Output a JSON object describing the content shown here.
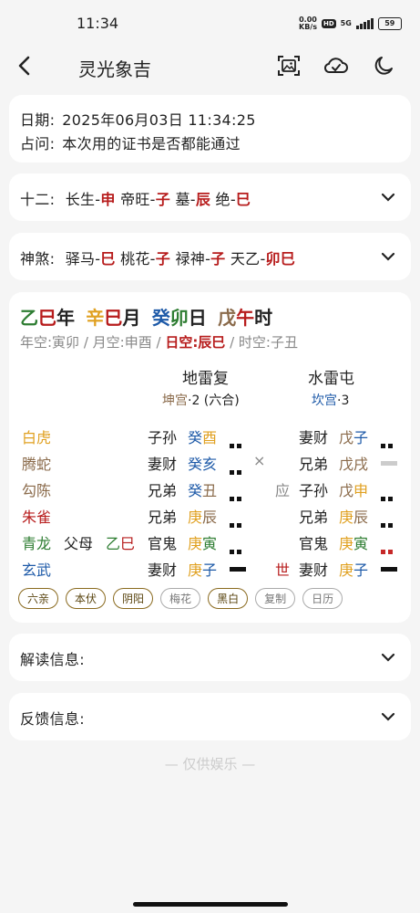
{
  "status": {
    "time": "11:34",
    "net_speed": "0.00",
    "net_unit": "KB/s",
    "hd": "HD",
    "sig": "5G",
    "battery": "59"
  },
  "header": {
    "title": "灵光象吉"
  },
  "info": {
    "date_label": "日期:",
    "date_value": "2025年06月03日 11:34:25",
    "question_label": "占问:",
    "question_value": "本次用的证书是否都能通过"
  },
  "twelve": {
    "label": "十二:",
    "items": [
      {
        "name": "长生-",
        "branch": "申"
      },
      {
        "name": "帝旺-",
        "branch": "子"
      },
      {
        "name": "墓-",
        "branch": "辰"
      },
      {
        "name": "绝-",
        "branch": "巳"
      }
    ]
  },
  "shensha": {
    "label": "神煞:",
    "items": [
      {
        "name": "驿马-",
        "branch": "巳"
      },
      {
        "name": "桃花-",
        "branch": "子"
      },
      {
        "name": "禄神-",
        "branch": "子"
      },
      {
        "name": "天乙-",
        "branch": "卯巳"
      }
    ]
  },
  "chart": {
    "pillars": [
      {
        "stem": "乙",
        "branch": "巳",
        "suffix": "年"
      },
      {
        "stem": "辛",
        "branch": "巳",
        "suffix": "月"
      },
      {
        "stem": "癸",
        "branch": "卯",
        "suffix": "日"
      },
      {
        "stem": "戊",
        "branch": "午",
        "suffix": "时"
      }
    ],
    "voids": {
      "year": "年空:寅卯",
      "sep1": " / ",
      "month": "月空:申酉",
      "sep2": " / ",
      "day": "日空:辰巳",
      "sep3": " / ",
      "hour": "时空:子丑"
    },
    "main_hex": {
      "name": "地雷复",
      "palace": "坤宫",
      "palace_rest": "·2 (六合)"
    },
    "changed_hex": {
      "name": "水雷屯",
      "palace": "坎宫",
      "palace_rest": "·3"
    },
    "lines": [
      {
        "god": "白虎",
        "hidden": "",
        "role": "子孙",
        "stem": "癸",
        "branch": "酉",
        "yao": "yin",
        "moving": "",
        "mark": "",
        "role2": "妻财",
        "stem2": "戊",
        "branch2": "子",
        "yao2": "yin"
      },
      {
        "god": "腾蛇",
        "hidden": "",
        "role": "妻财",
        "stem": "癸",
        "branch": "亥",
        "yao": "yin",
        "moving": "×",
        "mark": "",
        "role2": "兄弟",
        "stem2": "戊",
        "branch2": "戌",
        "yao2": "yang-gray"
      },
      {
        "god": "勾陈",
        "hidden": "",
        "role": "兄弟",
        "stem": "癸",
        "branch": "丑",
        "yao": "yin",
        "moving": "",
        "mark": "应",
        "role2": "子孙",
        "stem2": "戊",
        "branch2": "申",
        "yao2": "yin"
      },
      {
        "god": "朱雀",
        "hidden": "",
        "role": "兄弟",
        "stem": "庚",
        "branch": "辰",
        "yao": "yin",
        "moving": "",
        "mark": "",
        "role2": "兄弟",
        "stem2": "庚",
        "branch2": "辰",
        "yao2": "yin"
      },
      {
        "god": "青龙",
        "hidden": "父母",
        "hidden_stem": "乙",
        "hidden_branch": "巳",
        "role": "官鬼",
        "stem": "庚",
        "branch": "寅",
        "yao": "yin",
        "moving": "",
        "mark": "",
        "role2": "官鬼",
        "stem2": "庚",
        "branch2": "寅",
        "yao2": "yin-red"
      },
      {
        "god": "玄武",
        "hidden": "",
        "role": "妻财",
        "stem": "庚",
        "branch": "子",
        "yao": "yang",
        "moving": "",
        "mark": "世",
        "role2": "妻财",
        "stem2": "庚",
        "branch2": "子",
        "yao2": "yang"
      }
    ],
    "tags": [
      "六亲",
      "本伏",
      "阴阳",
      "梅花",
      "黑白",
      "复制",
      "日历"
    ]
  },
  "sections": {
    "interpret": "解读信息:",
    "feedback": "反馈信息:"
  },
  "footer": {
    "note": "— 仅供娱乐 —"
  },
  "colors": {
    "accent_red": "#b71c1c",
    "wood_green": "#2e7d32",
    "metal_orange": "#e0a020",
    "water_blue": "#1e5aa8",
    "earth_brown": "#8a6a4a"
  }
}
